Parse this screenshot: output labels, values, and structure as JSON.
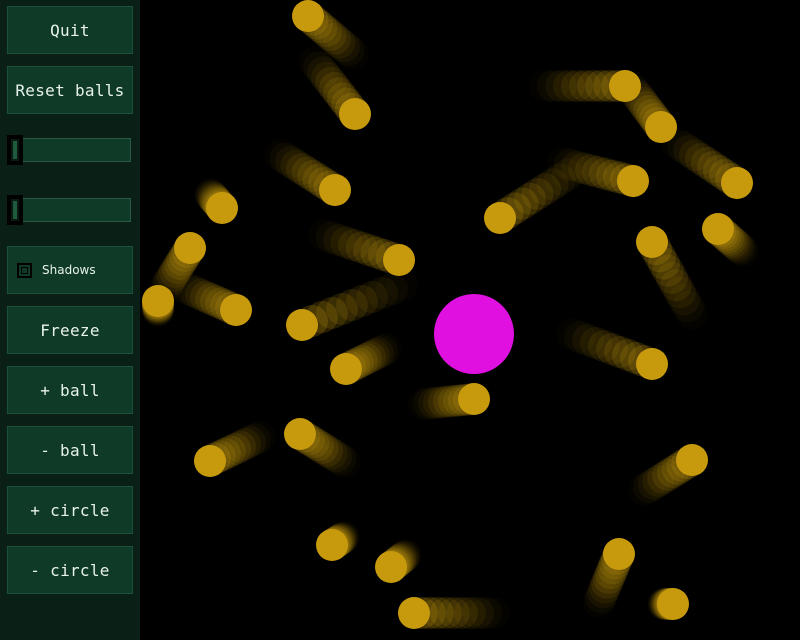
{
  "sidebar": {
    "quit_label": "Quit",
    "reset_label": "Reset balls",
    "shadows_label": "Shadows",
    "shadows_checked": false,
    "freeze_label": "Freeze",
    "add_ball_label": "+ ball",
    "remove_ball_label": "- ball",
    "add_circle_label": "+ circle",
    "remove_circle_label": "- circle",
    "slider1_value": 0,
    "slider2_value": 0
  },
  "colors": {
    "sidebar_bg": "#0a2016",
    "button_bg": "#0f3a27",
    "button_text": "#e8f2ec",
    "ball": "#c79a0e",
    "circle": "#e010e0",
    "background": "#000000"
  },
  "scene": {
    "ball_count": 28,
    "circle_count": 1
  }
}
